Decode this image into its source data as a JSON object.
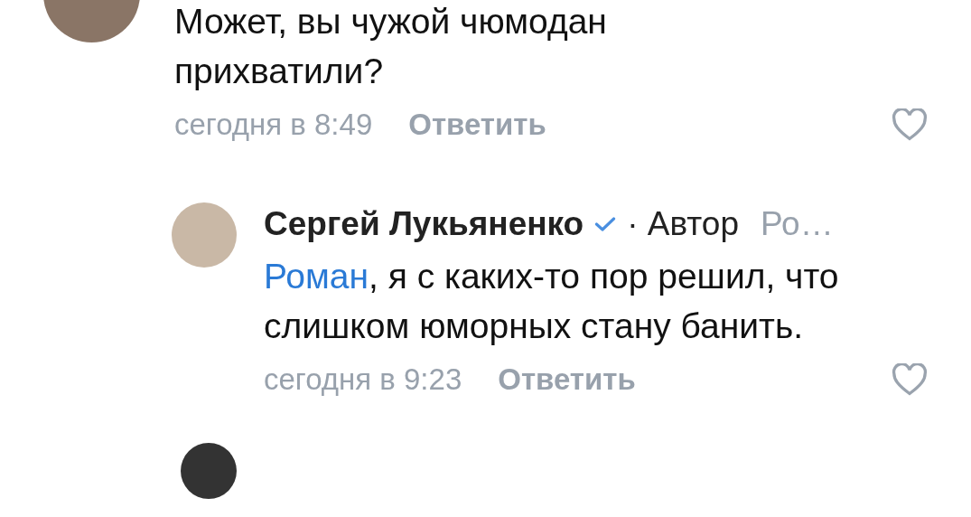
{
  "comments": [
    {
      "text": "Может, вы чужой чюмодан прихватили?",
      "time": "сегодня в 8:49",
      "reply": "Ответить",
      "liked": false
    },
    {
      "author": "Сергей Лукьяненко",
      "verified": true,
      "role": "· Автор",
      "reply_to": "Ро…",
      "mention": "Роман",
      "text": ", я с каких-то пор решил, что слишком юморных стану банить.",
      "time": "сегодня в 9:23",
      "reply": "Ответить",
      "liked": false
    }
  ]
}
